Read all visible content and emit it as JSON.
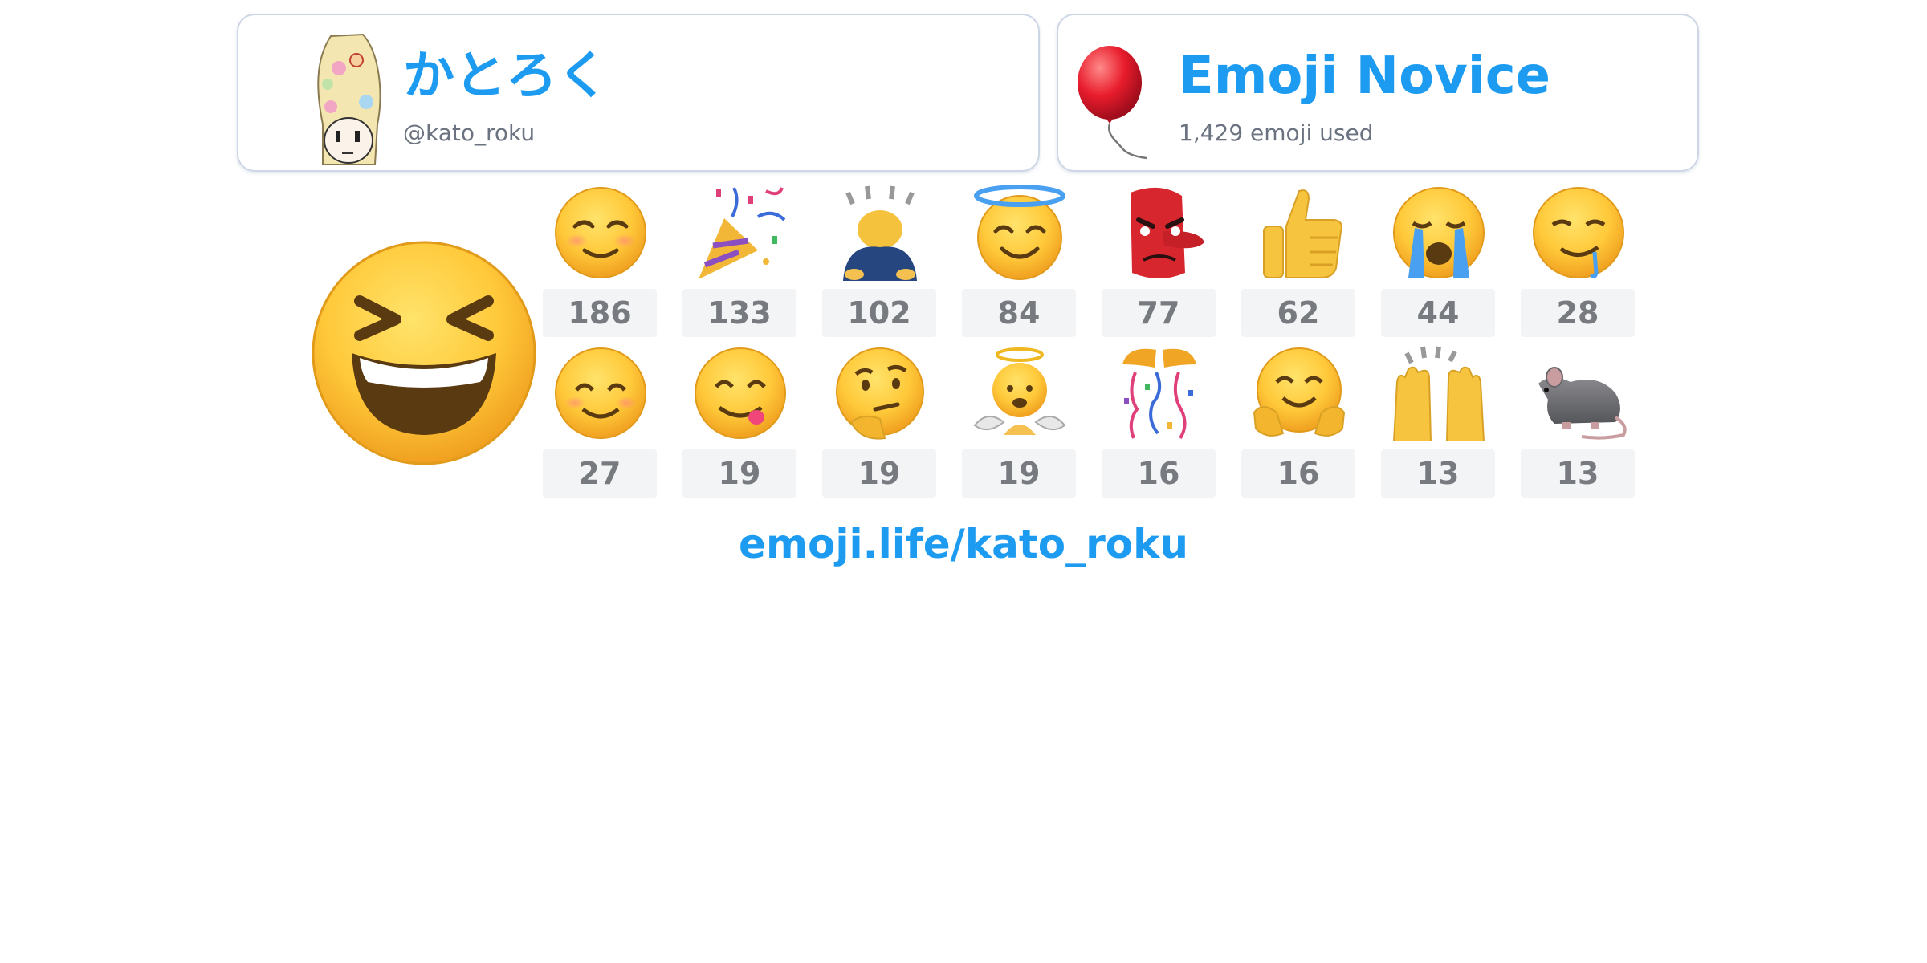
{
  "profile": {
    "display_name": "かとろく",
    "handle": "@kato_roku",
    "avatar_icon": "anime-character-avatar-icon"
  },
  "rank": {
    "title": "Emoji Novice",
    "subtitle": "1,429 emoji used",
    "icon": "balloon-icon"
  },
  "top_emoji": {
    "icon": "grinning-squinting-face-icon"
  },
  "emoji_counts": [
    {
      "icon": "smiling-face-icon",
      "count": "186"
    },
    {
      "icon": "party-popper-icon",
      "count": "133"
    },
    {
      "icon": "person-bowing-icon",
      "count": "102"
    },
    {
      "icon": "smiling-face-with-halo-icon",
      "count": "84"
    },
    {
      "icon": "goblin-tengu-icon",
      "count": "77"
    },
    {
      "icon": "thumbs-up-icon",
      "count": "62"
    },
    {
      "icon": "loudly-crying-face-icon",
      "count": "44"
    },
    {
      "icon": "drooling-face-icon",
      "count": "28"
    },
    {
      "icon": "smiling-face-with-smiling-eyes-icon",
      "count": "27"
    },
    {
      "icon": "face-savoring-food-icon",
      "count": "19"
    },
    {
      "icon": "thinking-face-icon",
      "count": "19"
    },
    {
      "icon": "baby-angel-icon",
      "count": "19"
    },
    {
      "icon": "confetti-ball-icon",
      "count": "16"
    },
    {
      "icon": "hugging-face-icon",
      "count": "16"
    },
    {
      "icon": "raising-hands-icon",
      "count": "13"
    },
    {
      "icon": "rat-icon",
      "count": "13"
    }
  ],
  "footer": {
    "link_text": "emoji.life/kato_roku"
  },
  "colors": {
    "accent": "#1d9bf0",
    "card_border": "#cdd6e4",
    "count_bg": "#f3f4f6",
    "count_text": "#777b80",
    "subtext": "#6b7280"
  }
}
